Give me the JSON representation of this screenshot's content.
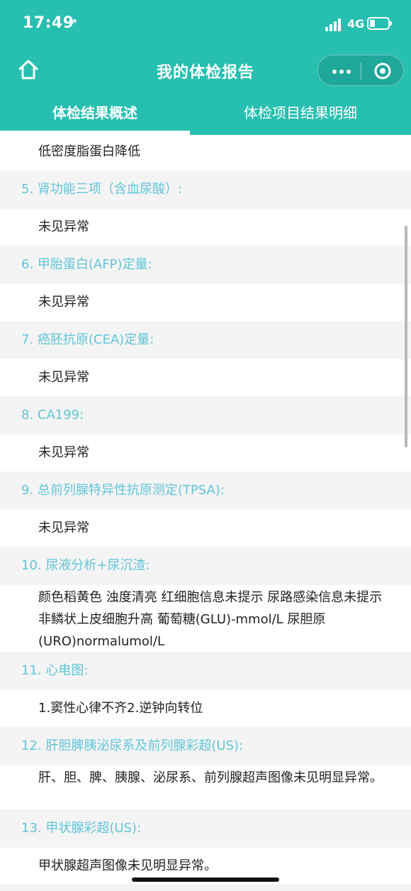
{
  "status_bar": {
    "time": "17:49",
    "location_icon": "location-arrow-icon",
    "network": "4G"
  },
  "nav": {
    "title": "我的体检报告",
    "home_icon": "home-icon",
    "more_icon": "more-dots-icon",
    "close_icon": "target-circle-icon"
  },
  "tabs": [
    {
      "label": "体检结果概述",
      "active": true
    },
    {
      "label": "体检项目结果明细",
      "active": false
    }
  ],
  "results": {
    "top_value": "低密度脂蛋白降低",
    "items": [
      {
        "title": "5. 肾功能三项（含血尿酸）:",
        "value": "未见异常"
      },
      {
        "title": "6. 甲胎蛋白(AFP)定量:",
        "value": "未见异常"
      },
      {
        "title": "7. 癌胚抗原(CEA)定量:",
        "value": "未见异常"
      },
      {
        "title": "8. CA199:",
        "value": "未见异常"
      },
      {
        "title": "9. 总前列腺特异性抗原测定(TPSA):",
        "value": "未见异常"
      },
      {
        "title": "10. 尿液分析+尿沉渣:",
        "value": "颜色稻黄色 浊度清亮 红细胞信息未提示 尿路感染信息未提示 非鳞状上皮细胞升高 葡萄糖(GLU)-mmol/L 尿胆原(URO)normalumol/L"
      },
      {
        "title": "11. 心电图:",
        "value": "1.窦性心律不齐2.逆钟向转位"
      },
      {
        "title": "12. 肝胆脾胰泌尿系及前列腺彩超(US):",
        "value": "肝、胆、脾、胰腺、泌尿系、前列腺超声图像未见明显异常。"
      },
      {
        "title": "13. 甲状腺彩超(US):",
        "value": "甲状腺超声图像未见明显异常。"
      }
    ]
  },
  "colors": {
    "header_bg": "#26bfb0",
    "section_title": "#61c5d9",
    "page_bg": "#f4f4f4"
  }
}
